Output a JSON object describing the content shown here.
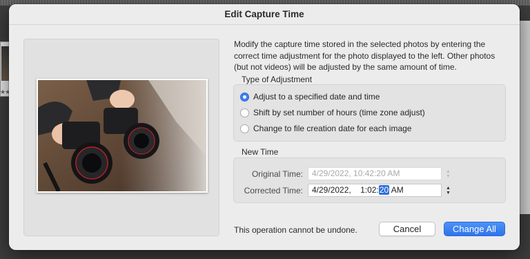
{
  "dialog": {
    "title": "Edit Capture Time",
    "description": "Modify the capture time stored in the selected photos by entering the correct time adjustment for the photo displayed to the left. Other photos (but not videos) will be adjusted by the same amount of time.",
    "adjustment": {
      "label": "Type of Adjustment",
      "options": [
        {
          "label": "Adjust to a specified date and time",
          "selected": true
        },
        {
          "label": "Shift by set number of hours (time zone adjust)",
          "selected": false
        },
        {
          "label": "Change to file creation date for each image",
          "selected": false
        }
      ]
    },
    "new_time": {
      "label": "New Time",
      "original_label": "Original Time:",
      "original_value": "4/29/2022, 10:42:20 AM",
      "corrected_label": "Corrected Time:",
      "corrected_date": "4/29/2022,",
      "corrected_time_prefix": "1:02:",
      "corrected_seconds": "20",
      "corrected_ampm": "AM"
    },
    "warning": "This operation cannot be undone.",
    "buttons": {
      "cancel": "Cancel",
      "confirm": "Change All"
    }
  },
  "background": {
    "stars": "★★"
  },
  "colors": {
    "accent": "#2f74eb",
    "dialog_bg": "#ececec"
  },
  "icons": {
    "stepper": "stepper-icon",
    "preview": "camera-photo-preview"
  }
}
